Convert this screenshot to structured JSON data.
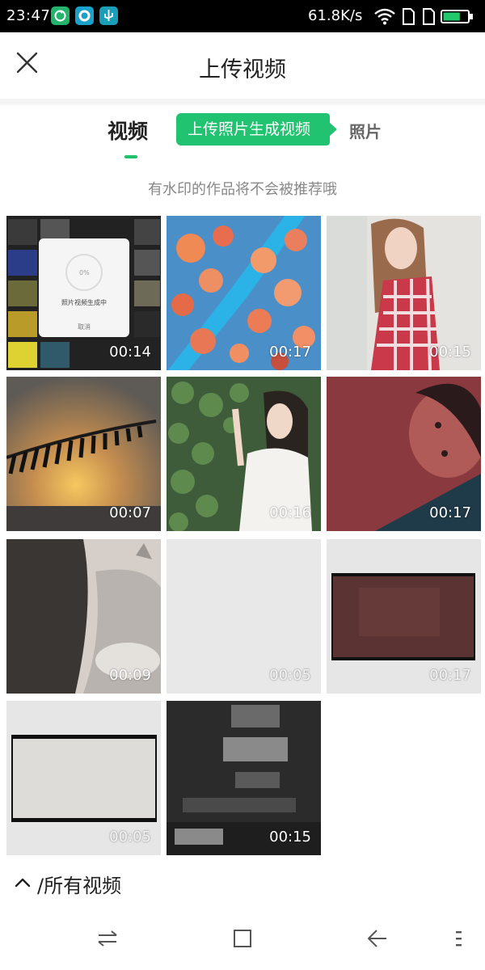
{
  "status_bar": {
    "time": "23:47",
    "net_speed": "61.8K/s",
    "app_icons": [
      {
        "name": "sync-app-icon",
        "color": "#23b36b"
      },
      {
        "name": "bird-app-icon",
        "color": "#1aa1c9"
      },
      {
        "name": "usb-icon",
        "color": "#1a9eb8"
      }
    ],
    "battery_level": 0.7
  },
  "header": {
    "title": "上传视频",
    "close_icon": "close-icon"
  },
  "tabs": {
    "video": "视频",
    "promo": "上传照片生成视频",
    "photo": "照片"
  },
  "hint": "有水印的作品将不会被推荐哦",
  "videos": [
    {
      "duration": "00:14",
      "thumb": "screen-recording"
    },
    {
      "duration": "00:17",
      "thumb": "aerial-flowers-river"
    },
    {
      "duration": "00:15",
      "thumb": "girl-red-dress"
    },
    {
      "duration": "00:07",
      "thumb": "sunset-palm-leaf"
    },
    {
      "duration": "00:16",
      "thumb": "girl-white-dress-plants"
    },
    {
      "duration": "00:17",
      "thumb": "red-portrait"
    },
    {
      "duration": "00:09",
      "thumb": "cat-on-sofa"
    },
    {
      "duration": "00:05",
      "thumb": "blank-light"
    },
    {
      "duration": "00:17",
      "thumb": "dark-red-frame"
    },
    {
      "duration": "00:05",
      "thumb": "grey-frame"
    },
    {
      "duration": "00:15",
      "thumb": "dark-motion-blur"
    }
  ],
  "progress_dialog": {
    "percent": "0%",
    "message": "照片视频生成中",
    "cancel": "取消"
  },
  "album": {
    "label": "/所有视频"
  },
  "colors": {
    "accent": "#22c370",
    "underline": "#1fc26b"
  }
}
